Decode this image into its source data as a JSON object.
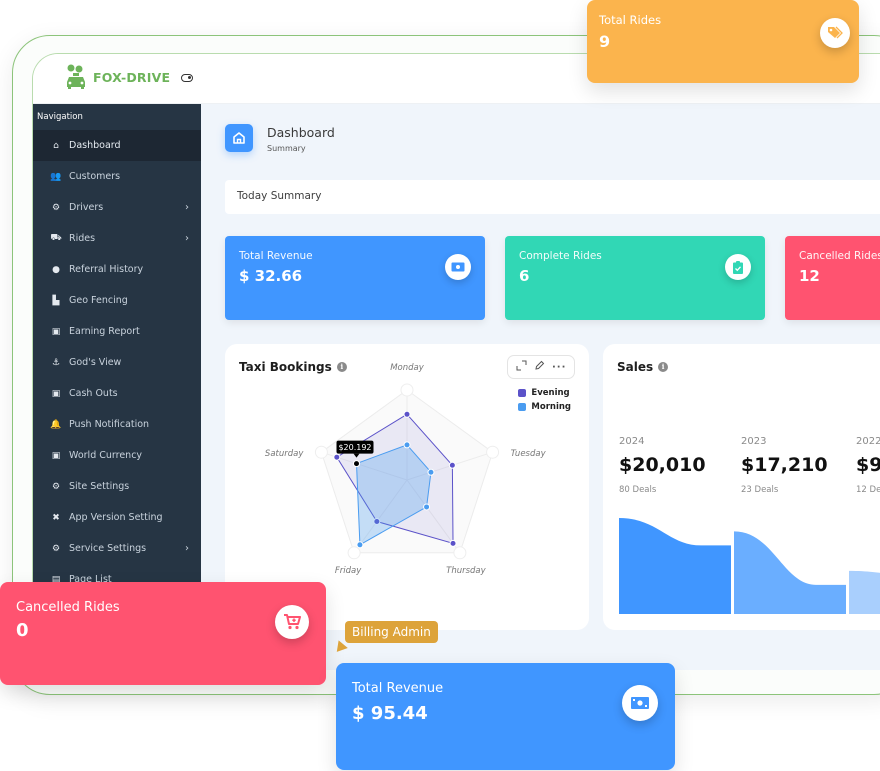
{
  "app": {
    "brand": "FOX-DRIVE"
  },
  "sidebar": {
    "heading": "Navigation",
    "items": [
      {
        "label": "Dashboard",
        "icon": "home-icon",
        "active": true,
        "has_submenu": false
      },
      {
        "label": "Customers",
        "icon": "users-icon",
        "active": false,
        "has_submenu": false
      },
      {
        "label": "Drivers",
        "icon": "motorcycle-icon",
        "active": false,
        "has_submenu": true
      },
      {
        "label": "Rides",
        "icon": "car-icon",
        "active": false,
        "has_submenu": true
      },
      {
        "label": "Referral History",
        "icon": "circle-icon",
        "active": false,
        "has_submenu": false
      },
      {
        "label": "Geo Fencing",
        "icon": "area-chart-icon",
        "active": false,
        "has_submenu": false
      },
      {
        "label": "Earning Report",
        "icon": "money-icon",
        "active": false,
        "has_submenu": false
      },
      {
        "label": "God's View",
        "icon": "anchor-icon",
        "active": false,
        "has_submenu": false
      },
      {
        "label": "Cash Outs",
        "icon": "money-icon",
        "active": false,
        "has_submenu": false
      },
      {
        "label": "Push Notification",
        "icon": "bell-icon",
        "active": false,
        "has_submenu": false
      },
      {
        "label": "World Currency",
        "icon": "money-icon",
        "active": false,
        "has_submenu": false
      },
      {
        "label": "Site Settings",
        "icon": "users-cog-icon",
        "active": false,
        "has_submenu": false
      },
      {
        "label": "App Version Setting",
        "icon": "tools-icon",
        "active": false,
        "has_submenu": false
      },
      {
        "label": "Service Settings",
        "icon": "gear-icon",
        "active": false,
        "has_submenu": true
      },
      {
        "label": "Page List",
        "icon": "clipboard-icon",
        "active": false,
        "has_submenu": false
      }
    ]
  },
  "header": {
    "title": "Dashboard",
    "subtitle": "Summary"
  },
  "summary": {
    "label": "Today Summary"
  },
  "stat_cards": [
    {
      "label": "Total Revenue",
      "value": "$ 32.66",
      "color": "#4096ff",
      "icon": "money-icon"
    },
    {
      "label": "Complete Rides",
      "value": "6",
      "color": "#31d7b5",
      "icon": "clipboard-check-icon"
    },
    {
      "label": "Cancelled Rides",
      "value": "12",
      "color": "#ff5370",
      "icon": "cart-icon"
    }
  ],
  "taxi_bookings": {
    "title": "Taxi Bookings",
    "tools": [
      "expand-icon",
      "edit-icon",
      "more-icon"
    ],
    "tooltip": "$20.192"
  },
  "sales": {
    "title": "Sales",
    "years": [
      {
        "year": "2024",
        "amount": "$20,010",
        "deals": "80 Deals"
      },
      {
        "year": "2023",
        "amount": "$17,210",
        "deals": "23 Deals"
      },
      {
        "year": "2022",
        "amount": "$9,",
        "deals": "12 De"
      }
    ]
  },
  "floating": {
    "total_rides": {
      "label": "Total Rides",
      "value": "9",
      "color": "#fbb44d",
      "icon": "tags-icon"
    },
    "cancelled_rides": {
      "label": "Cancelled Rides",
      "value": "0",
      "color": "#ff5370",
      "icon": "cart-icon"
    },
    "total_revenue": {
      "label": "Total Revenue",
      "value": "$ 95.44",
      "color": "#4096ff",
      "icon": "money-icon"
    },
    "billing_tag": "Billing Admin"
  },
  "chart_data": [
    {
      "type": "radar",
      "title": "Taxi Bookings",
      "categories": [
        "Monday",
        "Tuesday",
        "Thursday",
        "Friday",
        "Saturday"
      ],
      "range": [
        0,
        100
      ],
      "legend": "top-right",
      "series": [
        {
          "name": "Evening",
          "color": "#5b52c9",
          "values": [
            73,
            53,
            87,
            57,
            82
          ]
        },
        {
          "name": "Morning",
          "color": "#4a9cf0",
          "values": [
            39,
            28,
            37,
            89,
            59
          ]
        }
      ],
      "tooltip": {
        "series": "Morning",
        "category": "Saturday",
        "text": "$20.192"
      }
    },
    {
      "type": "area",
      "title": "Sales",
      "categories": [
        "2024",
        "2023",
        "2022"
      ],
      "series": [
        {
          "name": "Sales",
          "values": [
            20010,
            17210,
            9000
          ],
          "colors": [
            "#4096ff",
            "#6aaeff",
            "#a9cffd"
          ]
        }
      ]
    }
  ]
}
